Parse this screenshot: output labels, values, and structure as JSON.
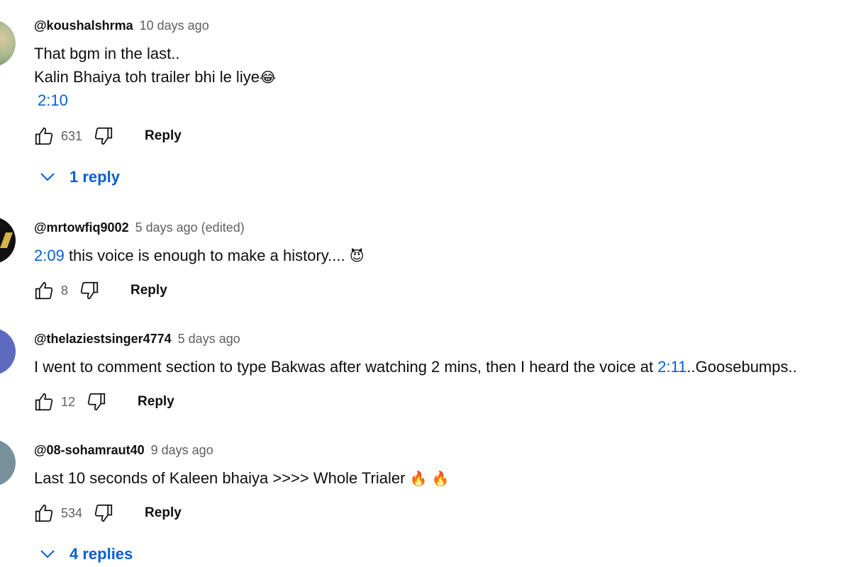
{
  "comments": [
    {
      "author": "@koushalshrma",
      "time": "10 days ago",
      "lines": [
        "That bgm in the last..",
        "Kalin Bhaiya toh trailer bhi le liye"
      ],
      "emoji": "😂",
      "timestamp": "2:10",
      "likes": "631",
      "reply_label": "Reply",
      "replies_label": "1 reply"
    },
    {
      "author": "@mrtowfiq9002",
      "time": "5 days ago (edited)",
      "timestamp": "2:09",
      "text": " this voice is enough to make a history.... ",
      "emoji": "😈",
      "likes": "8",
      "reply_label": "Reply"
    },
    {
      "author": "@thelaziestsinger4774",
      "time": "5 days ago",
      "text_before": "I went to comment section to type Bakwas after watching 2 mins, then I heard the voice at ",
      "timestamp": "2:11",
      "text_after": "..Goosebumps..",
      "likes": "12",
      "reply_label": "Reply"
    },
    {
      "author": "@08-sohamraut40",
      "time": "9 days ago",
      "text": "Last 10 seconds of Kaleen bhaiya >>>> Whole Trialer ",
      "emoji": "🔥 🔥",
      "likes": "534",
      "reply_label": "Reply",
      "replies_label": "4 replies"
    }
  ],
  "icons": {
    "like": "thumbs-up-icon",
    "dislike": "thumbs-down-icon",
    "expand": "chevron-down-icon"
  },
  "colors": {
    "link": "#065fd4",
    "secondary_text": "#606060"
  }
}
